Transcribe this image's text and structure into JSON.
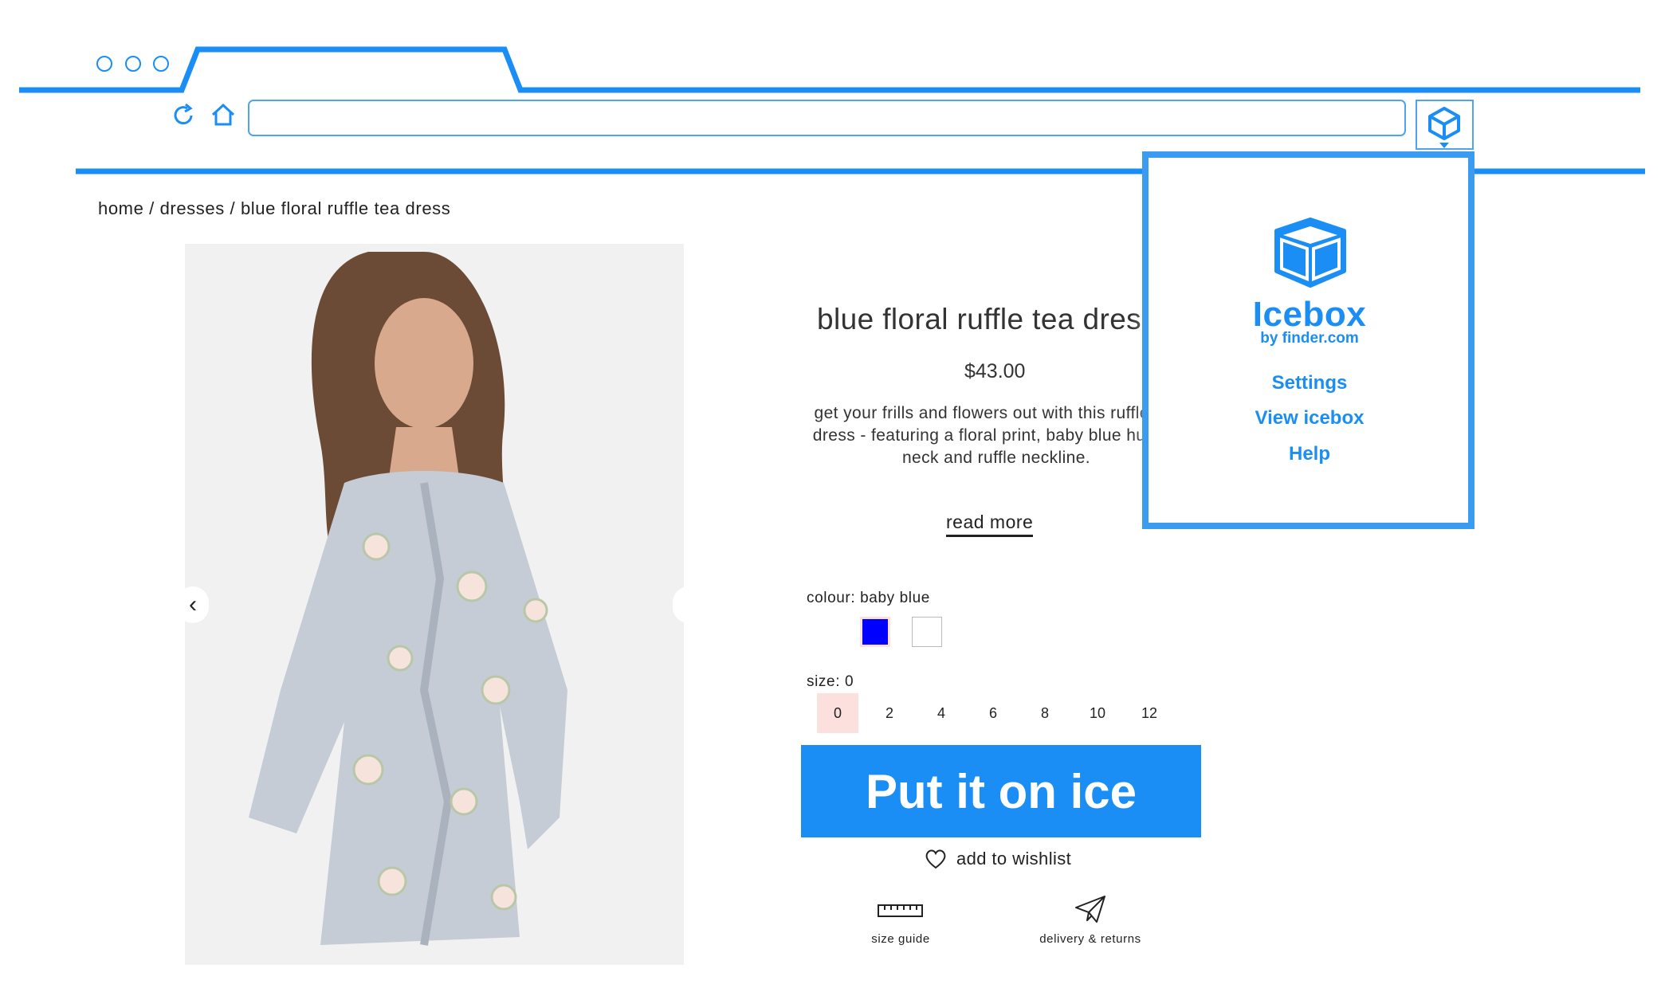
{
  "colors": {
    "accent": "#1a8ef5",
    "swatch_selected": "#0000ff",
    "size_selected_bg": "#fbe0dd"
  },
  "browser": {
    "icons": [
      "reload-icon",
      "home-icon",
      "icebox-extension-icon"
    ]
  },
  "breadcrumb": "home / dresses / blue floral ruffle tea dress",
  "product": {
    "title": "blue floral ruffle tea dress",
    "price": "$43.00",
    "description": "get your frills and flowers out with this ruffle tea dress - featuring a floral print, baby blue hue, v-neck and ruffle neckline.",
    "read_more": "read more",
    "colour_label": "colour: baby blue",
    "size_label": "size: 0",
    "sizes": [
      "0",
      "2",
      "4",
      "6",
      "8",
      "10",
      "12"
    ],
    "cta": "Put it on ice",
    "wishlist": "add to wishlist",
    "size_guide": "size guide",
    "delivery": "delivery & returns"
  },
  "popup": {
    "brand": "Icebox",
    "brand_sub": "by finder.com",
    "menu": [
      "Settings",
      "View icebox",
      "Help"
    ]
  }
}
